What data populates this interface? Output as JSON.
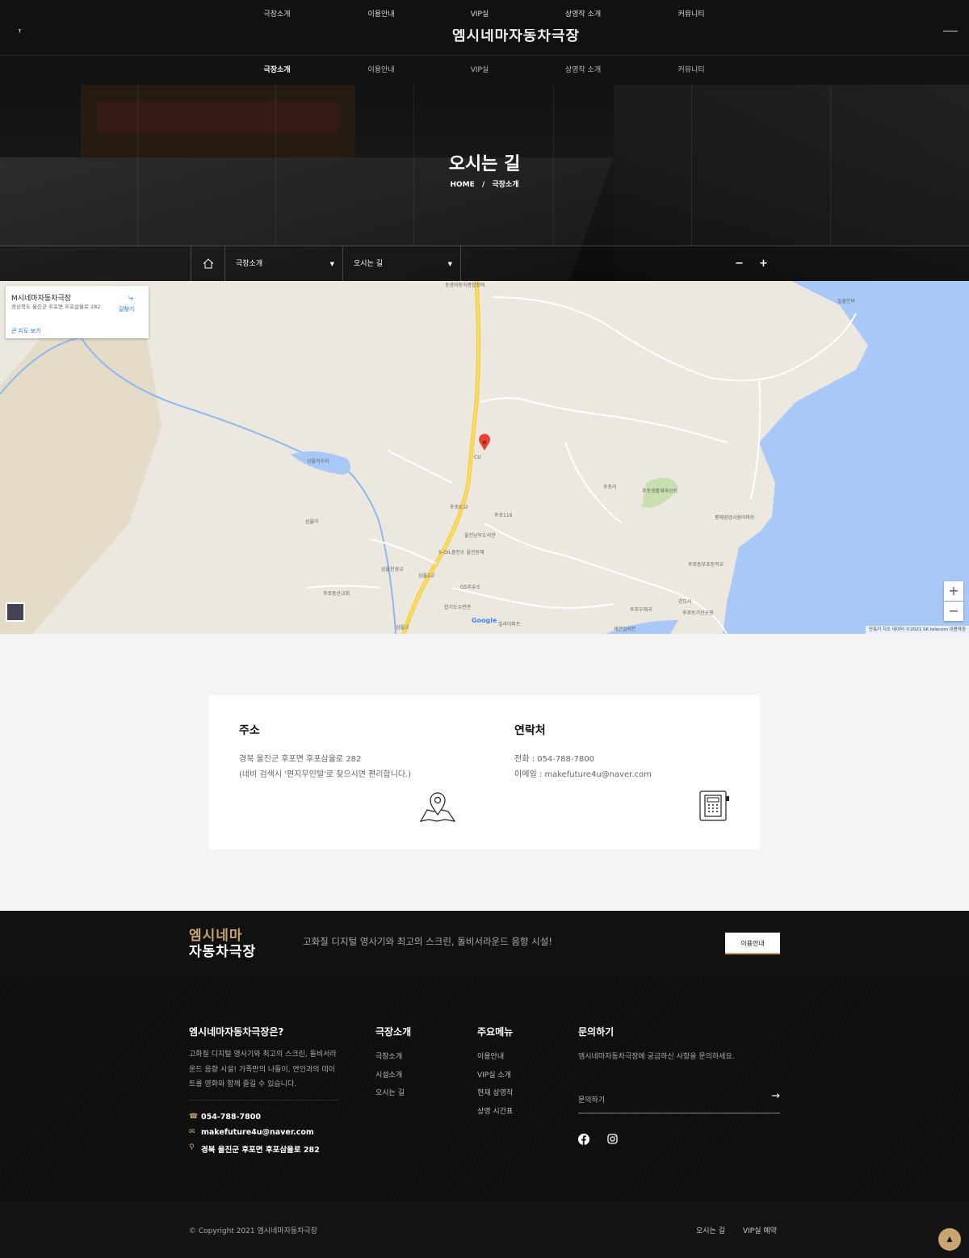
{
  "topnav": {
    "items": [
      "극장소개",
      "이용안내",
      "VIP실",
      "상영작 소개",
      "커뮤니티"
    ]
  },
  "header": {
    "logo": "엠시네마자동차극장",
    "search_icon": "search-icon",
    "menu_icon": "hamburger-icon"
  },
  "mainnav": {
    "items": [
      "극장소개",
      "이용안내",
      "VIP실",
      "상영작 소개",
      "커뮤니티"
    ],
    "active": "극장소개"
  },
  "hero": {
    "title": "오시는 길",
    "breadcrumb_home": "HOME",
    "breadcrumb_sep": "/",
    "breadcrumb_current": "극장소개",
    "subbar": {
      "select1": "극장소개",
      "select2": "오시는 길",
      "minus": "−",
      "plus": "+"
    }
  },
  "map": {
    "info_title": "M시네마자동차극장",
    "info_address": "경상북도 울진군 후포면 후포삼율로 282",
    "info_directions": "길찾기",
    "info_link": "큰 지도 보기",
    "zoom_in": "+",
    "zoom_out": "−",
    "labels": [
      "동경자동차종합정비",
      "삼율저수지",
      "CU",
      "후포IC교",
      "후포119",
      "울진남부도서관",
      "S-OIL충전소 울진동해",
      "삼율한경교",
      "삼율2교",
      "GS주유소",
      "후포동산교회",
      "삼율리",
      "후포리",
      "후포생활체육공원",
      "평해광업사원아파트",
      "후포동부초등학교",
      "강도사",
      "후포우체국",
      "후포등기산공원",
      "세븐일레븐",
      "합기도수련관",
      "삼율교",
      "일출민박",
      "빌라아파트"
    ],
    "footer": "단축키   지도 데이터 ©2021 SK telecom   이용약관",
    "brand": "Google"
  },
  "contact": {
    "address": {
      "heading": "주소",
      "line1": "경북 울진군 후포면 후포삼율로 282",
      "line2": "(네비 검색시 '편지무인텔'로 찾으시면 편리합니다.)",
      "icon": "map-pin-icon"
    },
    "phone": {
      "heading": "연락처",
      "line1": "전화 : 054-788-7800",
      "line2": "이메일 : makefuture4u@naver.com",
      "icon": "telephone-icon"
    }
  },
  "cta": {
    "logo_top": "엠시네마",
    "logo_bottom": "자동차극장",
    "text": "고화질 디지털 영사기와 최고의 스크린, 돌비서라운드 음향 시설!",
    "button": "이용안내"
  },
  "footer": {
    "about_heading": "엠시네마자동차극장은?",
    "about_text": "고화질 디지털 영사기와 최고의 스크린, 돌비서라운드 음향 시설! 가족만의 나들이, 연인과의 데이트를 영화와 함께 즐길 수 있습니다.",
    "phone": "054-788-7800",
    "email": "makefuture4u@naver.com",
    "address": "경북 울진군 후포면 후포삼율로 282",
    "col2_heading": "극장소개",
    "col2_links": [
      "극장소개",
      "시설소개",
      "오시는 길"
    ],
    "col3_heading": "주요메뉴",
    "col3_links": [
      "이용안내",
      "VIP실 소개",
      "현재 상영작",
      "상영 시간표"
    ],
    "col4_heading": "문의하기",
    "col4_text": "엠시네마자동차극장에 궁금하신 사항을 문의하세요.",
    "inquiry_placeholder": "문의하기",
    "arrow": "→",
    "social": [
      "facebook-icon",
      "instagram-icon"
    ]
  },
  "bottom": {
    "copyright": "© Copyright 2021 엠시네마자동차극장",
    "links": [
      "오시는 길",
      "VIP실 예약"
    ],
    "totop": "▲"
  }
}
